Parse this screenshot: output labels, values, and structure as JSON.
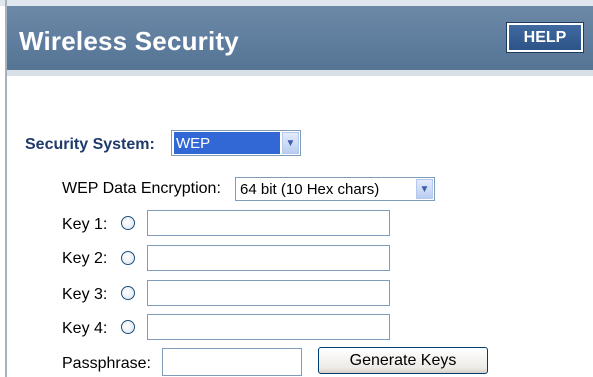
{
  "header": {
    "title": "Wireless Security",
    "help_label": "HELP"
  },
  "security_system": {
    "label": "Security System:",
    "value": "WEP"
  },
  "wep_encryption": {
    "label": "WEP Data Encryption:",
    "value": "64 bit (10 Hex chars)"
  },
  "keys": [
    {
      "label": "Key 1:",
      "value": ""
    },
    {
      "label": "Key 2:",
      "value": ""
    },
    {
      "label": "Key 3:",
      "value": ""
    },
    {
      "label": "Key 4:",
      "value": ""
    }
  ],
  "passphrase": {
    "label": "Passphrase:",
    "value": ""
  },
  "generate_label": "Generate Keys",
  "colors": {
    "header_bg": "#5f7d9e",
    "label_blue": "#1f3a6b",
    "selected_bg": "#3168d5"
  },
  "icons": {
    "dropdown": "chevron-down-icon",
    "radio": "radio-button-icon"
  }
}
